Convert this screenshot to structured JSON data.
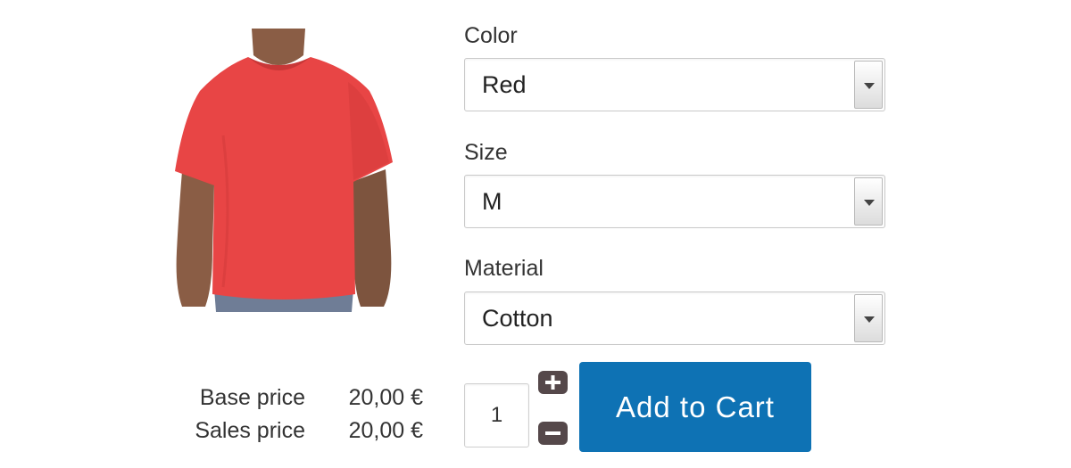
{
  "product": {
    "image_icon": "red-tshirt-photo",
    "color": "#e84545"
  },
  "prices": {
    "base_label": "Base price",
    "base_value": "20,00 €",
    "sales_label": "Sales price",
    "sales_value": "20,00 €"
  },
  "options": {
    "color": {
      "label": "Color",
      "value": "Red"
    },
    "size": {
      "label": "Size",
      "value": "M"
    },
    "material": {
      "label": "Material",
      "value": "Cotton"
    }
  },
  "quantity": {
    "value": "1",
    "increase_icon": "plus-icon",
    "decrease_icon": "minus-icon"
  },
  "cart": {
    "button_label": "Add to Cart",
    "accent": "#0e72b4"
  }
}
